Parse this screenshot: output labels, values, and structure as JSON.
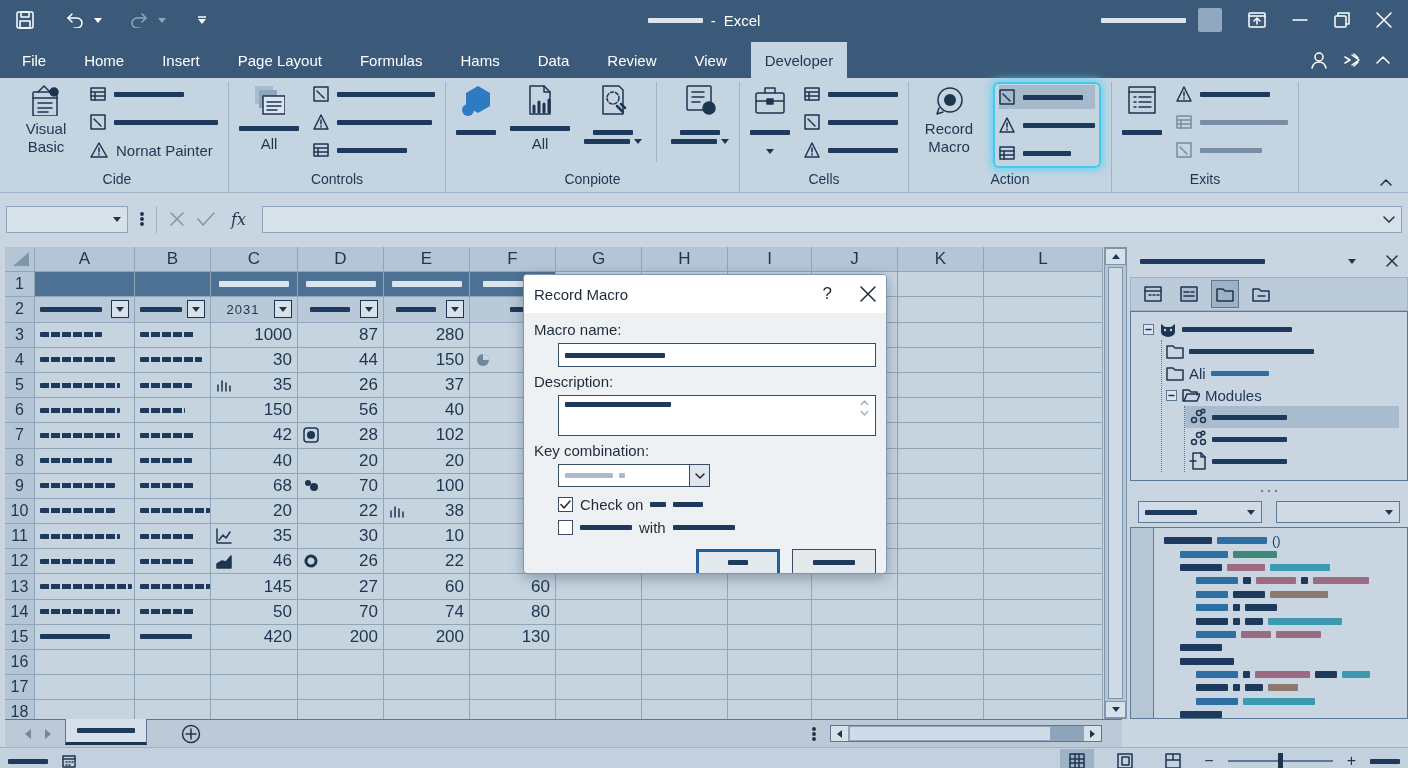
{
  "window": {
    "title_separator": "-",
    "title": "Excel"
  },
  "tabs": [
    {
      "label": "File",
      "selected": false
    },
    {
      "label": "Home",
      "selected": false
    },
    {
      "label": "Insert",
      "selected": false
    },
    {
      "label": "Page Layout",
      "selected": false
    },
    {
      "label": "Formulas",
      "selected": false
    },
    {
      "label": "Hams",
      "selected": false
    },
    {
      "label": "Data",
      "selected": false
    },
    {
      "label": "Review",
      "selected": false
    },
    {
      "label": "View",
      "selected": false
    },
    {
      "label": "Developer",
      "selected": true
    }
  ],
  "ribbon": {
    "groups": [
      {
        "label": "Cide",
        "highlighted": false,
        "items": [
          {
            "kind": "large",
            "label": "Visual Basic"
          },
          {
            "kind": "small-bar"
          },
          {
            "kind": "small-bar"
          },
          {
            "kind": "small",
            "label": "Nornat Painter"
          }
        ]
      },
      {
        "label": "Controls",
        "highlighted": false,
        "items": [
          {
            "kind": "large-bar-label",
            "label": "All"
          },
          {
            "kind": "small-bar"
          },
          {
            "kind": "small-bar"
          },
          {
            "kind": "small-bar"
          }
        ]
      },
      {
        "label": "Conpiote",
        "highlighted": false,
        "items": [
          {
            "kind": "large-bar"
          },
          {
            "kind": "large-bar-label",
            "label": "All"
          },
          {
            "kind": "large-bar-caret"
          },
          {
            "kind": "separator"
          },
          {
            "kind": "large-bar-caret"
          }
        ]
      },
      {
        "label": "Cells",
        "highlighted": false,
        "items": [
          {
            "kind": "large-caret"
          },
          {
            "kind": "small-bar"
          },
          {
            "kind": "small-bar"
          },
          {
            "kind": "small-bar"
          }
        ]
      },
      {
        "label": "Action",
        "highlighted": true,
        "items": [
          {
            "kind": "large",
            "label": "Record Macro"
          },
          {
            "kind": "small-bar"
          },
          {
            "kind": "small-bar"
          },
          {
            "kind": "small-bar"
          }
        ]
      },
      {
        "label": "Exits",
        "highlighted": false,
        "items": [
          {
            "kind": "large-bar"
          },
          {
            "kind": "small-bar",
            "disabled": false
          },
          {
            "kind": "small-bar",
            "disabled": true
          },
          {
            "kind": "small-bar",
            "disabled": true
          }
        ]
      }
    ]
  },
  "formula_bar": {
    "function_label": "fx"
  },
  "sheet": {
    "columns": [
      "A",
      "B",
      "C",
      "D",
      "E",
      "F",
      "G",
      "H",
      "I",
      "J",
      "K",
      "L"
    ],
    "rows": [
      {
        "number": "1",
        "kind": "header"
      },
      {
        "number": "2",
        "kind": "filter",
        "cells": [
          {
            "kind": "bar",
            "filter": true
          },
          {
            "kind": "bar",
            "filter": true
          },
          {
            "kind": "text",
            "text": "2031",
            "filter": true
          },
          {
            "kind": "bar",
            "filter": true
          },
          {
            "kind": "bar",
            "filter": true
          },
          {
            "kind": "bar",
            "filter": false
          }
        ]
      },
      {
        "number": "3",
        "kind": "data",
        "values": [
          "1000",
          "87",
          "280"
        ]
      },
      {
        "number": "4",
        "kind": "data",
        "values": [
          "30",
          "44",
          "150"
        ]
      },
      {
        "number": "5",
        "kind": "data",
        "values": [
          "35",
          "26",
          "37"
        ]
      },
      {
        "number": "6",
        "kind": "data",
        "values": [
          "150",
          "56",
          "40"
        ]
      },
      {
        "number": "7",
        "kind": "data",
        "values": [
          "42",
          "28",
          "102"
        ]
      },
      {
        "number": "8",
        "kind": "data",
        "values": [
          "40",
          "20",
          "20"
        ]
      },
      {
        "number": "9",
        "kind": "data",
        "values": [
          "68",
          "70",
          "100"
        ]
      },
      {
        "number": "10",
        "kind": "data",
        "values": [
          "20",
          "22",
          "38"
        ]
      },
      {
        "number": "11",
        "kind": "data",
        "values": [
          "35",
          "30",
          "10"
        ]
      },
      {
        "number": "12",
        "kind": "data",
        "values": [
          "46",
          "26",
          "22"
        ]
      },
      {
        "number": "13",
        "kind": "data",
        "values": [
          "145",
          "27",
          "60",
          "60"
        ]
      },
      {
        "number": "14",
        "kind": "data",
        "values": [
          "50",
          "70",
          "74",
          "80"
        ]
      },
      {
        "number": "15",
        "kind": "total",
        "values": [
          "420",
          "200",
          "200",
          "130"
        ]
      },
      {
        "number": "16",
        "kind": "empty"
      },
      {
        "number": "17",
        "kind": "empty"
      },
      {
        "number": "18",
        "kind": "empty"
      }
    ]
  },
  "sheet_tabs": [
    {
      "selected": true
    }
  ],
  "dialog": {
    "title": "Record Macro",
    "help": "?",
    "fields": [
      {
        "kind": "text",
        "label": "Macro name:"
      },
      {
        "kind": "textarea",
        "label": "Description:"
      },
      {
        "kind": "dropdown",
        "label": "Key combination:"
      }
    ],
    "options": [
      {
        "kind": "label-first",
        "label": "Check on",
        "checked": true
      },
      {
        "kind": "label-middle",
        "label": "with",
        "checked": false
      }
    ],
    "buttons": [
      {
        "focused": true
      },
      {
        "focused": false
      }
    ]
  },
  "explorer": {
    "toolbar": [
      {
        "selected": false
      },
      {
        "selected": false
      },
      {
        "selected": true
      },
      {
        "selected": false
      }
    ],
    "tree": [
      {
        "kind": "project",
        "expanded": true,
        "children": [
          {
            "kind": "folder"
          },
          {
            "kind": "folder",
            "label": "Ali"
          },
          {
            "kind": "folder",
            "label": "Modules",
            "expanded": true,
            "children": [
              {
                "kind": "module",
                "selected": true
              },
              {
                "kind": "module",
                "selected": false
              },
              {
                "kind": "class",
                "selected": false
              }
            ]
          }
        ]
      }
    ],
    "code_editor": {
      "signature_suffix": "()"
    }
  },
  "status_bar": {
    "views": [
      {
        "selected": true
      },
      {
        "selected": false
      },
      {
        "selected": false
      }
    ],
    "zoom": {
      "minus": "−",
      "plus": "+",
      "level": 0.5
    }
  }
}
